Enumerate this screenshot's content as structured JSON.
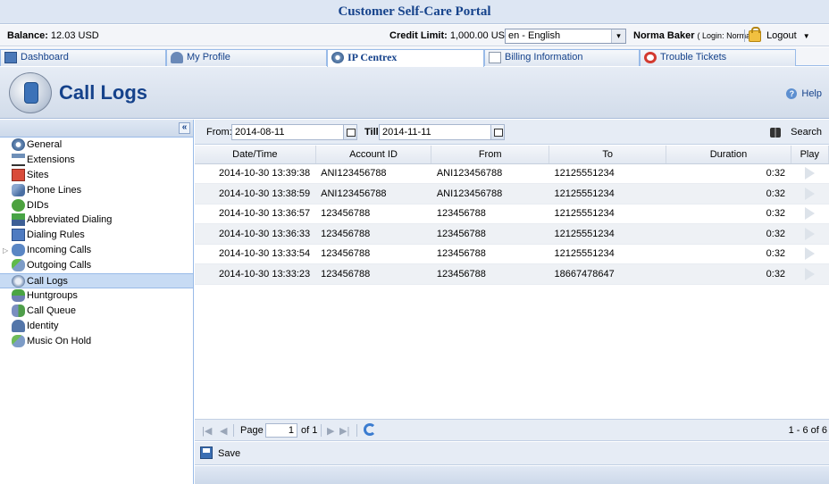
{
  "app": {
    "title": "Customer Self-Care Portal"
  },
  "account": {
    "balance_label": "Balance:",
    "balance_value": "12.03 USD",
    "credit_label": "Credit Limit:",
    "credit_value": "1,000.00 USD",
    "language": "en - English",
    "user_name": "Norma Baker",
    "login_text": "( Login: NormaB )",
    "logout_label": "Logout"
  },
  "tabs": [
    {
      "label": "Dashboard",
      "icon": "dashboard-icon"
    },
    {
      "label": "My Profile",
      "icon": "profile-icon"
    },
    {
      "label": "IP Centrex",
      "icon": "ip-centrex-icon",
      "active": true
    },
    {
      "label": "Billing Information",
      "icon": "billing-icon"
    },
    {
      "label": "Trouble Tickets",
      "icon": "lifebuoy-icon"
    }
  ],
  "page": {
    "title": "Call Logs",
    "help_label": "Help",
    "collapse_symbol": "«"
  },
  "sidebar": {
    "items": [
      {
        "label": "General",
        "icon": "gear-icon"
      },
      {
        "label": "Extensions",
        "icon": "extensions-icon"
      },
      {
        "label": "Sites",
        "icon": "sites-icon"
      },
      {
        "label": "Phone Lines",
        "icon": "phone-lines-icon"
      },
      {
        "label": "DIDs",
        "icon": "dids-icon"
      },
      {
        "label": "Abbreviated Dialing",
        "icon": "abbreviated-dialing-icon"
      },
      {
        "label": "Dialing Rules",
        "icon": "dialing-rules-icon"
      },
      {
        "label": "Incoming Calls",
        "icon": "incoming-calls-icon",
        "expandable": true
      },
      {
        "label": "Outgoing Calls",
        "icon": "outgoing-calls-icon"
      },
      {
        "label": "Call Logs",
        "icon": "call-logs-icon",
        "selected": true
      },
      {
        "label": "Huntgroups",
        "icon": "huntgroups-icon"
      },
      {
        "label": "Call Queue",
        "icon": "call-queue-icon"
      },
      {
        "label": "Identity",
        "icon": "identity-icon"
      },
      {
        "label": "Music On Hold",
        "icon": "music-on-hold-icon"
      }
    ]
  },
  "filter": {
    "from_label": "From:",
    "from_value": "2014-08-11",
    "till_label": "Till:",
    "till_value": "2014-11-11",
    "search_label": "Search"
  },
  "grid": {
    "columns": [
      "Date/Time",
      "Account ID",
      "From",
      "To",
      "Duration",
      "Play"
    ],
    "rows": [
      {
        "datetime": "2014-10-30 13:39:38",
        "account": "ANI123456788",
        "from": "ANI123456788",
        "to": "12125551234",
        "duration": "0:32"
      },
      {
        "datetime": "2014-10-30 13:38:59",
        "account": "ANI123456788",
        "from": "ANI123456788",
        "to": "12125551234",
        "duration": "0:32"
      },
      {
        "datetime": "2014-10-30 13:36:57",
        "account": "123456788",
        "from": "123456788",
        "to": "12125551234",
        "duration": "0:32"
      },
      {
        "datetime": "2014-10-30 13:36:33",
        "account": "123456788",
        "from": "123456788",
        "to": "12125551234",
        "duration": "0:32"
      },
      {
        "datetime": "2014-10-30 13:33:54",
        "account": "123456788",
        "from": "123456788",
        "to": "12125551234",
        "duration": "0:32"
      },
      {
        "datetime": "2014-10-30 13:33:23",
        "account": "123456788",
        "from": "123456788",
        "to": "18667478647",
        "duration": "0:32"
      }
    ]
  },
  "paging": {
    "page_label": "Page",
    "page_value": "1",
    "of_label": "of 1",
    "count_text": "1 - 6 of 6"
  },
  "save": {
    "label": "Save"
  }
}
